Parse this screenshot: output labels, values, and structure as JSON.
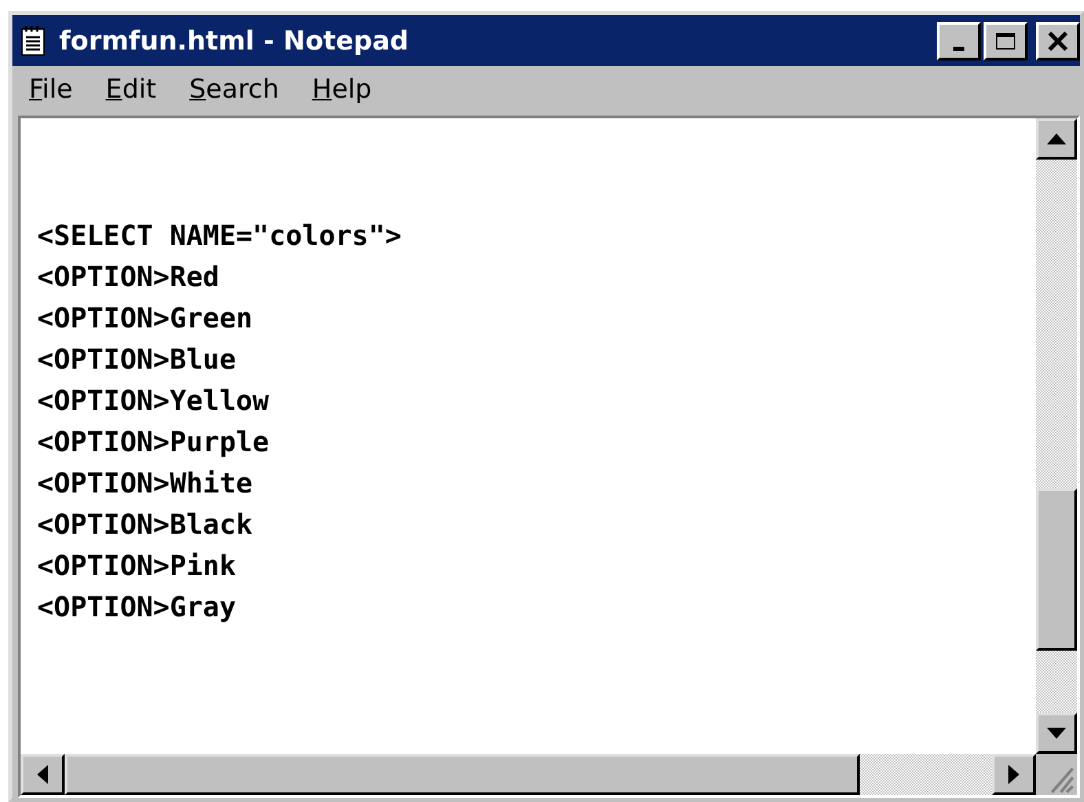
{
  "window": {
    "title": "formfun.html - Notepad"
  },
  "menu": [
    "File",
    "Edit",
    "Search",
    "Help"
  ],
  "editor": {
    "lines": [
      "<SELECT NAME=\"colors\">",
      "<OPTION>Red",
      "<OPTION>Green",
      "<OPTION>Blue",
      "<OPTION>Yellow",
      "<OPTION>Purple",
      "<OPTION>White",
      "<OPTION>Black",
      "<OPTION>Pink",
      "<OPTION>Gray"
    ]
  }
}
